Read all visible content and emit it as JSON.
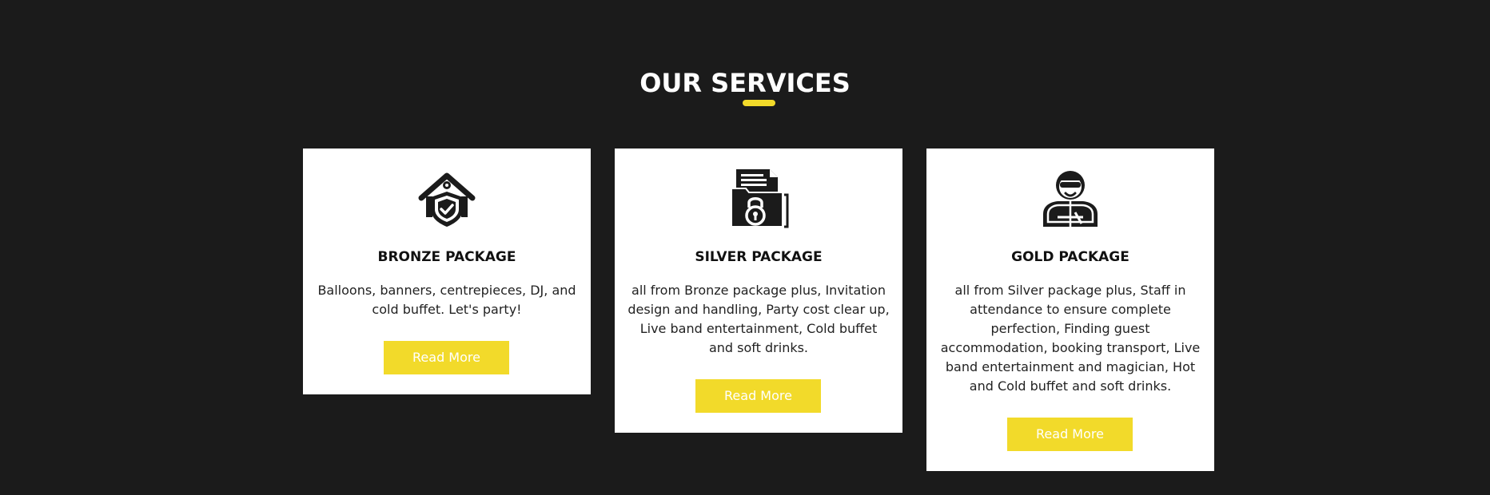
{
  "colors": {
    "background": "#1b1b1b",
    "accent": "#f2da2a",
    "card": "#ffffff"
  },
  "section": {
    "title": "OUR SERVICES"
  },
  "cards": [
    {
      "icon": "home-shield-icon",
      "title": "BRONZE PACKAGE",
      "description": "Balloons, banners, centrepieces, DJ, and cold buffet. Let's party!",
      "button_label": "Read More"
    },
    {
      "icon": "locked-folder-icon",
      "title": "SILVER PACKAGE",
      "description": "all from Bronze package plus, Invitation design and handling, Party cost clear up, Live band entertainment, Cold buffet and soft drinks.",
      "button_label": "Read More"
    },
    {
      "icon": "security-guard-icon",
      "title": "GOLD PACKAGE",
      "description": "all from Silver package plus, Staff in attendance to ensure complete perfection, Finding guest accommodation, booking transport, Live band entertainment and magician, Hot and Cold buffet and soft drinks.",
      "button_label": "Read More"
    }
  ]
}
